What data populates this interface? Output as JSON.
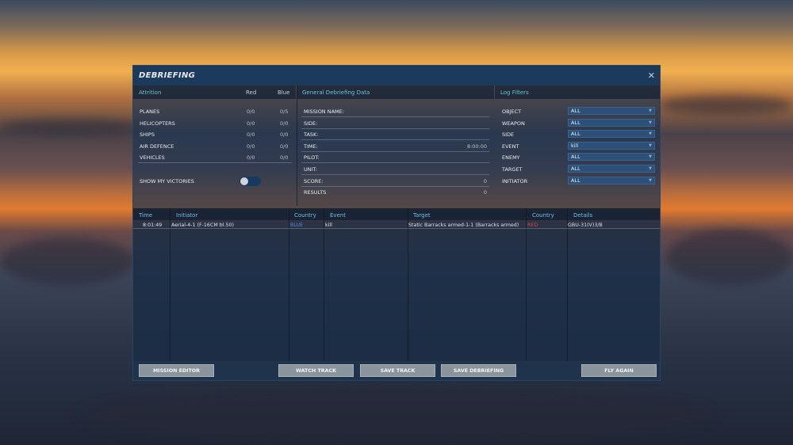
{
  "title": "DEBRIEFING",
  "attrition": {
    "header": "Attrition",
    "col_red": "Red",
    "col_blue": "Blue",
    "rows": [
      {
        "label": "PLANES",
        "red": "0/0",
        "blue": "0/5"
      },
      {
        "label": "HELICOPTERS",
        "red": "0/0",
        "blue": "0/0"
      },
      {
        "label": "SHIPS",
        "red": "0/0",
        "blue": "0/0"
      },
      {
        "label": "AIR DEFENCE",
        "red": "0/0",
        "blue": "0/0"
      },
      {
        "label": "VEHICLES",
        "red": "0/0",
        "blue": "0/0"
      }
    ],
    "show_victories": "SHOW MY VICTORIES",
    "show_victories_on": false
  },
  "general": {
    "header": "General Debriefing Data",
    "rows": [
      {
        "label": "MISSION NAME:",
        "value": ""
      },
      {
        "label": "SIDE:",
        "value": ""
      },
      {
        "label": "TASK:",
        "value": ""
      },
      {
        "label": "TIME:",
        "value": "8:00:00"
      },
      {
        "label": "PILOT:",
        "value": ""
      },
      {
        "label": "UNIT:",
        "value": ""
      },
      {
        "label": "SCORE:",
        "value": "0"
      },
      {
        "label": "RESULTS",
        "value": "0"
      }
    ]
  },
  "filters": {
    "header": "Log Filters",
    "rows": [
      {
        "label": "OBJECT",
        "value": "ALL"
      },
      {
        "label": "WEAPON",
        "value": "ALL"
      },
      {
        "label": "SIDE",
        "value": "ALL"
      },
      {
        "label": "EVENT",
        "value": "kill"
      },
      {
        "label": "ENEMY",
        "value": "ALL"
      },
      {
        "label": "TARGET",
        "value": "ALL"
      },
      {
        "label": "INITIATOR",
        "value": "ALL"
      }
    ]
  },
  "log": {
    "columns": [
      "Time",
      "Initiator",
      "Country",
      "Event",
      "Target",
      "Country",
      "Details"
    ],
    "rows": [
      {
        "time": "8:01:49",
        "initiator": "Aerial-4-1 (F-16CM bl.50)",
        "country": "BLUE",
        "event": "kill",
        "target": "Static Barracks armed-1-1 (Barracks armed)",
        "target_country": "RED",
        "details": "GBU-31(V)3/B"
      }
    ]
  },
  "buttons": {
    "mission_editor": "MISSION EDITOR",
    "watch_track": "WATCH TRACK",
    "save_track": "SAVE TRACK",
    "save_debriefing": "SAVE DEBRIEFING",
    "fly_again": "FLY AGAIN"
  },
  "colors": {
    "blue_side": "#4a8cd8",
    "red_side": "#e04040",
    "accent": "#6cc0d8"
  }
}
